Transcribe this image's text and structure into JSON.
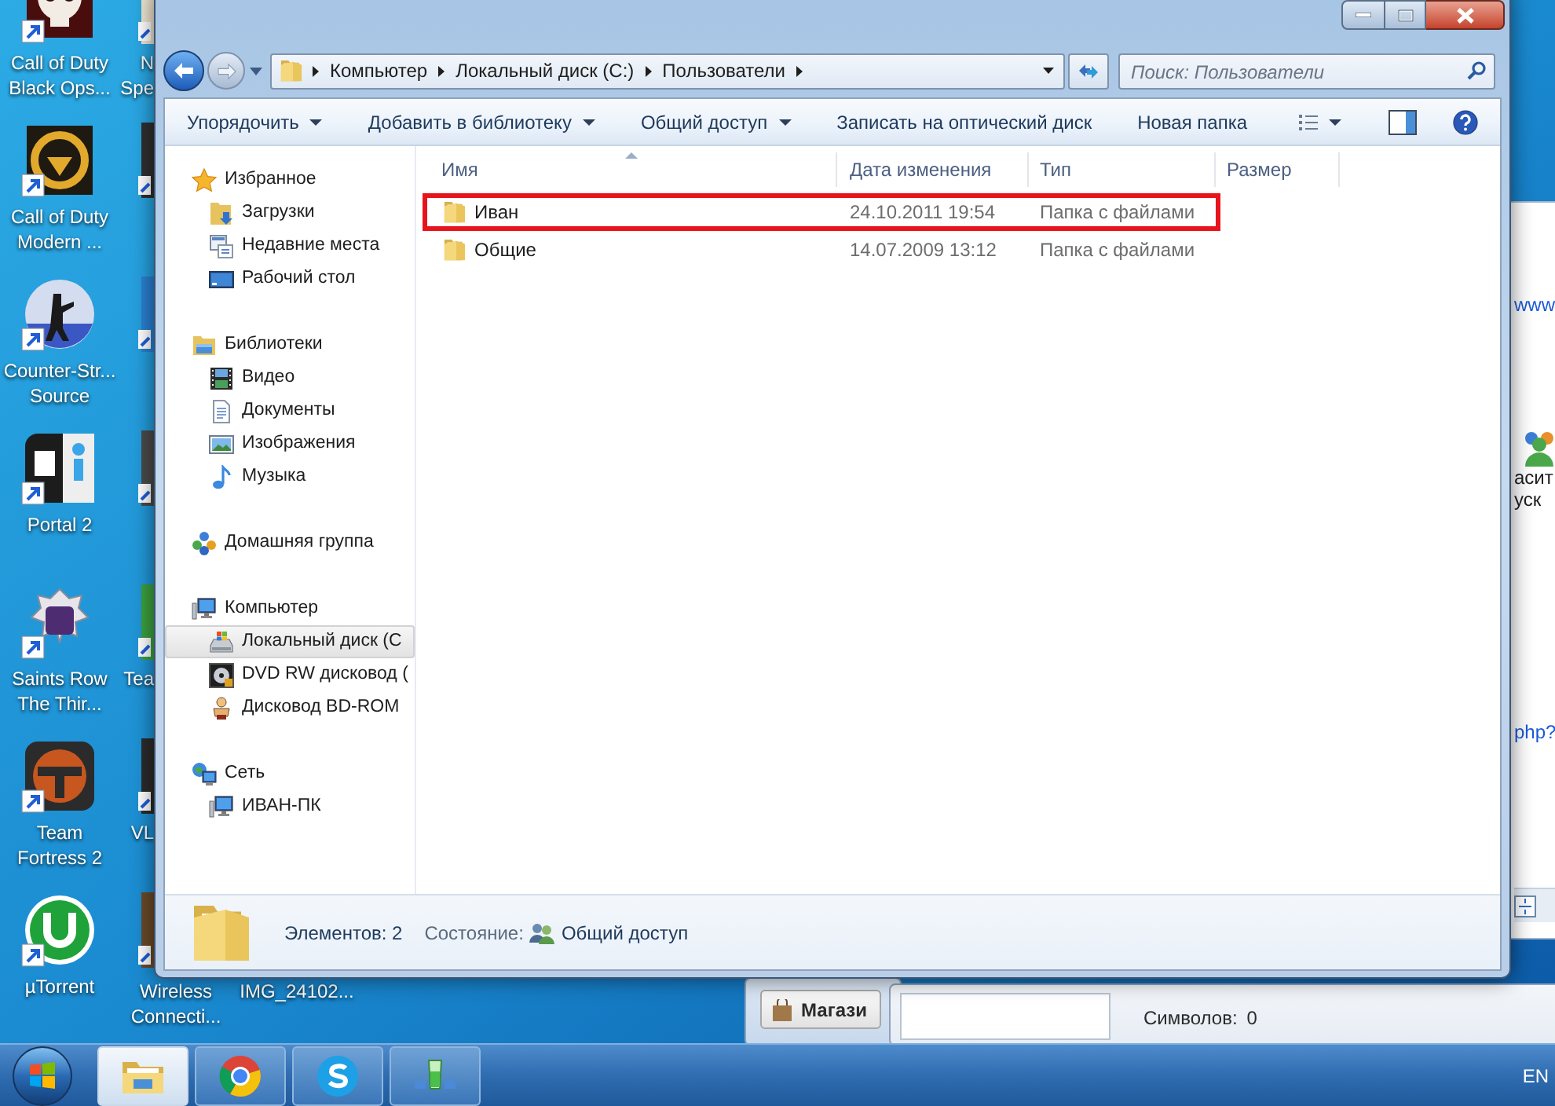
{
  "desktop": {
    "column_1": [
      {
        "lines": [
          "Call of Duty",
          "Black Ops..."
        ]
      },
      {
        "lines": [
          "Call of Duty",
          "Modern ..."
        ]
      },
      {
        "lines": [
          "Counter-Str...",
          "Source"
        ]
      },
      {
        "lines": [
          "Portal 2"
        ]
      },
      {
        "lines": [
          "Saints Row",
          "The Thir..."
        ]
      },
      {
        "lines": [
          "Team",
          "Fortress 2"
        ]
      },
      {
        "lines": [
          "µTorrent"
        ]
      }
    ],
    "column_2": [
      {
        "lines": [
          "N",
          "Spe"
        ]
      },
      {
        "lines": [
          "Tea"
        ]
      },
      {
        "lines": [
          "VL"
        ]
      },
      {
        "lines": [
          "Wireless",
          "Connecti..."
        ]
      }
    ],
    "column_3": [
      {
        "lines": [
          "IMG_24102..."
        ]
      }
    ]
  },
  "explorer": {
    "address": {
      "crumbs": [
        "Компьютер",
        "Локальный диск (C:)",
        "Пользователи"
      ]
    },
    "search": {
      "placeholder": "Поиск: Пользователи"
    },
    "toolbar": [
      {
        "label": "Упорядочить",
        "dropdown": true
      },
      {
        "label": "Добавить в библиотеку",
        "dropdown": true
      },
      {
        "label": "Общий доступ",
        "dropdown": true
      },
      {
        "label": "Записать на оптический диск",
        "dropdown": false
      },
      {
        "label": "Новая папка",
        "dropdown": false
      }
    ],
    "sidebar": [
      {
        "label": "Избранное",
        "selected": false,
        "children": [
          {
            "label": "Загрузки",
            "selected": false
          },
          {
            "label": "Недавние места",
            "selected": false
          },
          {
            "label": "Рабочий стол",
            "selected": false
          }
        ]
      },
      {
        "label": "Библиотеки",
        "selected": false,
        "children": [
          {
            "label": "Видео",
            "selected": false
          },
          {
            "label": "Документы",
            "selected": false
          },
          {
            "label": "Изображения",
            "selected": false
          },
          {
            "label": "Музыка",
            "selected": false
          }
        ]
      },
      {
        "label": "Домашняя группа",
        "selected": false
      },
      {
        "label": "Компьютер",
        "selected": false,
        "children": [
          {
            "label": "Локальный диск (C",
            "selected": true
          },
          {
            "label": "DVD RW дисковод (",
            "selected": false
          },
          {
            "label": "Дисковод BD-ROM",
            "selected": false
          }
        ]
      },
      {
        "label": "Сеть",
        "selected": false,
        "children": [
          {
            "label": "ИВАН-ПК",
            "selected": false
          }
        ]
      }
    ],
    "table": {
      "columns": [
        {
          "label": "Имя",
          "sorted": true
        },
        {
          "label": "Дата изменения",
          "sorted": false
        },
        {
          "label": "Тип",
          "sorted": false
        },
        {
          "label": "Размер",
          "sorted": false
        }
      ],
      "rows": [
        {
          "name": "Иван",
          "date": "24.10.2011 19:54",
          "type": "Папка с файлами",
          "highlighted": true
        },
        {
          "name": "Общие",
          "date": "14.07.2009 13:12",
          "type": "Папка с файлами",
          "highlighted": false
        }
      ]
    },
    "details": {
      "count": "Элементов: 2",
      "state_label": "Состояние:",
      "state_value": "Общий доступ"
    }
  },
  "background": {
    "right_window": {
      "texts": [
        {
          "text": "www",
          "kind": "link"
        },
        {
          "text": "асит",
          "kind": "text"
        },
        {
          "text": "уск",
          "kind": "text"
        },
        {
          "text": "php?",
          "kind": "link"
        }
      ]
    },
    "shop_button": "Магази",
    "counter_label": "Символов:",
    "counter_value": "0"
  },
  "taskbar": {
    "buttons": [
      {
        "selected": true
      },
      {
        "selected": false
      },
      {
        "selected": false
      },
      {
        "selected": false
      }
    ],
    "language": "EN"
  }
}
